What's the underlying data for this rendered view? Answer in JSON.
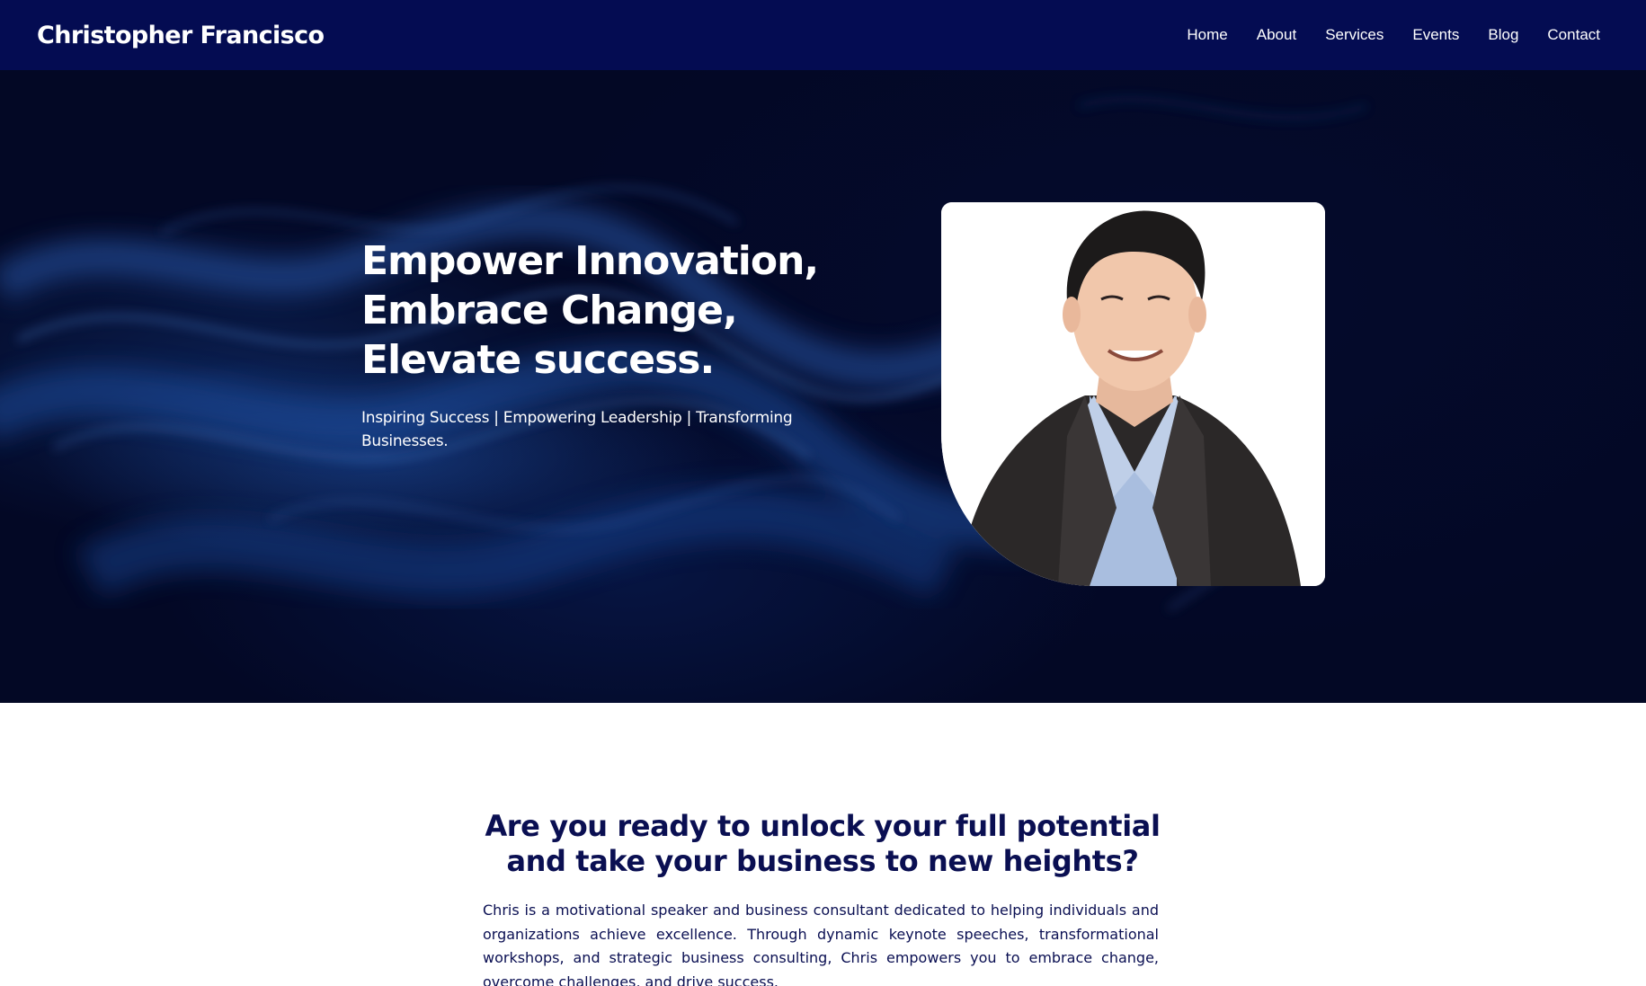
{
  "header": {
    "brand": "Christopher Francisco",
    "nav": [
      {
        "label": "Home"
      },
      {
        "label": "About"
      },
      {
        "label": "Services"
      },
      {
        "label": "Events"
      },
      {
        "label": "Blog"
      },
      {
        "label": "Contact"
      }
    ]
  },
  "hero": {
    "title_lines": [
      "Empower Innovation,",
      "Embrace Change,",
      "Elevate success."
    ],
    "subtitle": "Inspiring Success | Empowering Leadership | Transforming Businesses."
  },
  "intro": {
    "heading": "Are you ready to unlock your full potential and take your business to new heights?",
    "body": "Chris is a motivational speaker and business consultant dedicated to helping individuals and organizations achieve excellence. Through dynamic keynote speeches, transformational workshops, and strategic business consulting, Chris empowers you to embrace change, overcome challenges, and drive success."
  },
  "colors": {
    "navbar": "#040c52",
    "hero_background": "#030825",
    "heading_text": "#0a0f52"
  }
}
